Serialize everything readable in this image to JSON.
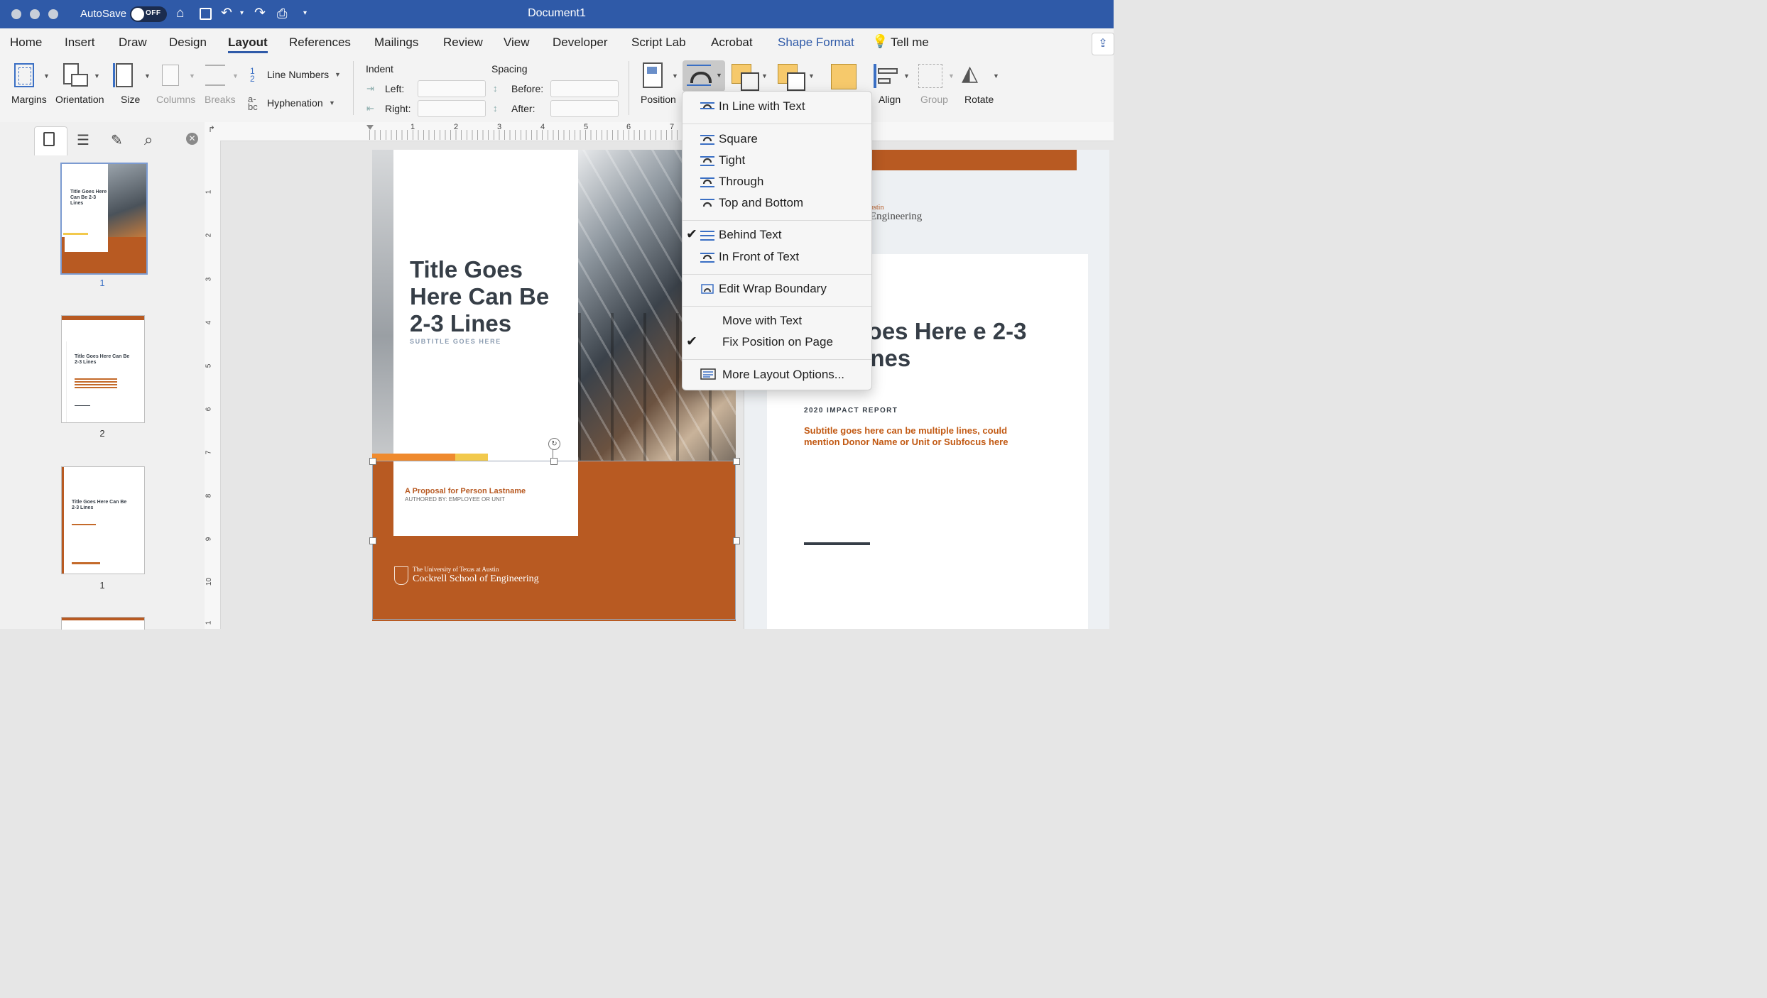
{
  "titlebar": {
    "autosave_label": "AutoSave",
    "toggle_state": "OFF",
    "document_title": "Document1"
  },
  "tabs": [
    {
      "label": "Home"
    },
    {
      "label": "Insert"
    },
    {
      "label": "Draw"
    },
    {
      "label": "Design"
    },
    {
      "label": "Layout",
      "active": true
    },
    {
      "label": "References"
    },
    {
      "label": "Mailings"
    },
    {
      "label": "Review"
    },
    {
      "label": "View"
    },
    {
      "label": "Developer"
    },
    {
      "label": "Script Lab"
    },
    {
      "label": "Acrobat"
    },
    {
      "label": "Shape Format"
    },
    {
      "label": "Tell me"
    }
  ],
  "ribbon": {
    "margins": "Margins",
    "orientation": "Orientation",
    "size": "Size",
    "columns": "Columns",
    "breaks": "Breaks",
    "line_numbers": "Line Numbers",
    "hyphenation": "Hyphenation",
    "indent_header": "Indent",
    "indent_left": "Left:",
    "indent_right": "Right:",
    "spacing_header": "Spacing",
    "spacing_before": "Before:",
    "spacing_after": "After:",
    "position": "Position",
    "align": "Align",
    "group": "Group",
    "rotate": "Rotate"
  },
  "wrap_menu": {
    "items": [
      {
        "label": "In Line with Text",
        "checked": false
      },
      {
        "label": "Square",
        "checked": false
      },
      {
        "label": "Tight",
        "checked": false
      },
      {
        "label": "Through",
        "checked": false
      },
      {
        "label": "Top and Bottom",
        "checked": false
      },
      {
        "label": "Behind Text",
        "checked": true
      },
      {
        "label": "In Front of Text",
        "checked": false
      },
      {
        "label": "Edit Wrap Boundary",
        "checked": false
      },
      {
        "label": "Move with Text",
        "checked": false
      },
      {
        "label": "Fix Position on Page",
        "checked": true
      },
      {
        "label": "More Layout Options...",
        "checked": false
      }
    ]
  },
  "thumbnails": [
    {
      "number": "1",
      "title": "Title Goes Here Can Be 2-3 Lines",
      "selected": true
    },
    {
      "number": "2",
      "title": "Title Goes Here Can Be 2-3 Lines"
    },
    {
      "number": "1",
      "title": "Title Goes Here Can Be 2-3 Lines"
    }
  ],
  "ruler": {
    "horizontal": [
      "1",
      "2",
      "3",
      "4",
      "5",
      "6",
      "7"
    ],
    "vertical": [
      "1",
      "2",
      "3",
      "4",
      "5",
      "6",
      "7",
      "8",
      "9",
      "10",
      "1"
    ]
  },
  "page1": {
    "title": "Title Goes Here Can Be 2-3 Lines",
    "subtitle": "SUBTITLE GOES HERE",
    "proposal": "A Proposal for Person Lastname",
    "authored": "AUTHORED BY: EMPLOYEE OR UNIT",
    "univ_line1": "The University of Texas at Austin",
    "univ_line2": "Cockrell School of Engineering"
  },
  "page2": {
    "logo_fragment_1": "ustin",
    "logo_fragment_2": "Engineering",
    "title_fragment": "Goes Here e 2-3 Lines",
    "report_label": "2020 IMPACT REPORT",
    "subtitle": "Subtitle goes here can be multiple lines, could mention Donor Name or Unit or Subfocus here"
  },
  "colors": {
    "titlebar": "#2f5aa8",
    "accent_orange": "#b85a22",
    "accent_yellow": "#f2c94c",
    "title_text": "#363e47"
  }
}
